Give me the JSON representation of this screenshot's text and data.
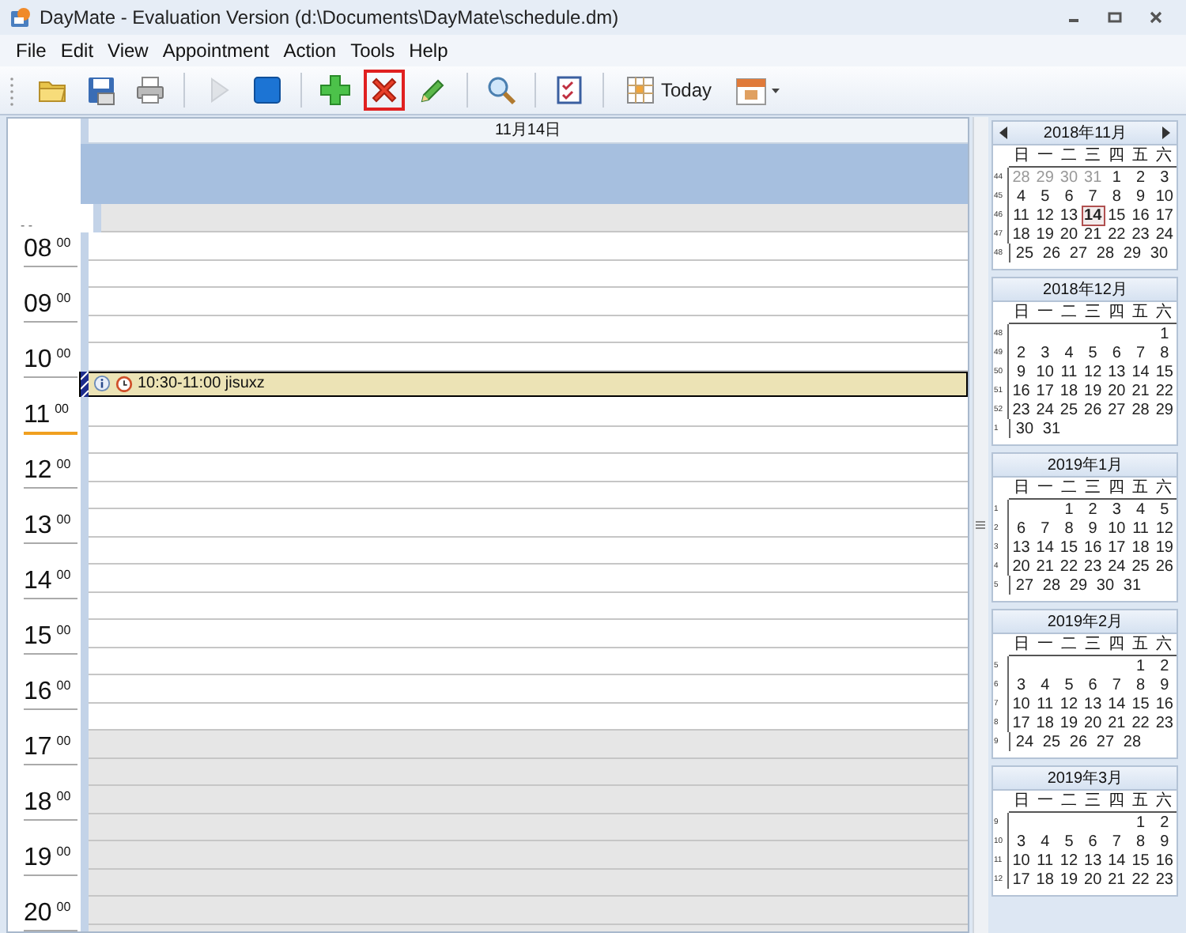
{
  "window": {
    "title": "DayMate - Evaluation Version (d:\\Documents\\DayMate\\schedule.dm)"
  },
  "menu": [
    {
      "label": "File"
    },
    {
      "label": "Edit"
    },
    {
      "label": "View"
    },
    {
      "label": "Appointment"
    },
    {
      "label": "Action"
    },
    {
      "label": "Tools"
    },
    {
      "label": "Help"
    }
  ],
  "toolbar": [
    {
      "kind": "open",
      "disabled": false,
      "highlighted": false
    },
    {
      "kind": "save",
      "disabled": false,
      "highlighted": false
    },
    {
      "kind": "print",
      "disabled": false,
      "highlighted": false
    },
    {
      "kind": "separator"
    },
    {
      "kind": "run",
      "disabled": true,
      "highlighted": false
    },
    {
      "kind": "stop",
      "disabled": false,
      "highlighted": false
    },
    {
      "kind": "separator"
    },
    {
      "kind": "add",
      "disabled": false,
      "highlighted": false
    },
    {
      "kind": "delete",
      "disabled": false,
      "highlighted": true
    },
    {
      "kind": "edit",
      "disabled": false,
      "highlighted": false
    },
    {
      "kind": "separator"
    },
    {
      "kind": "find",
      "disabled": false,
      "highlighted": false
    },
    {
      "kind": "separator"
    },
    {
      "kind": "tasks",
      "disabled": false,
      "highlighted": false
    },
    {
      "kind": "separator"
    },
    {
      "kind": "today",
      "label": "Today",
      "disabled": false,
      "highlighted": false
    },
    {
      "kind": "calendar",
      "disabled": false,
      "highlighted": false
    }
  ],
  "day_view": {
    "date": "11月14日",
    "top_slot_label": "- -",
    "hours": [
      {
        "hour": "08",
        "minutes": "00",
        "work": true,
        "now": false
      },
      {
        "hour": "09",
        "minutes": "00",
        "work": true,
        "now": false
      },
      {
        "hour": "10",
        "minutes": "00",
        "work": true,
        "now": false,
        "half_past_appointment": {
          "text": "10:30-11:00 jisuxz"
        }
      },
      {
        "hour": "11",
        "minutes": "00",
        "work": true,
        "now": true
      },
      {
        "hour": "12",
        "minutes": "00",
        "work": true,
        "now": false
      },
      {
        "hour": "13",
        "minutes": "00",
        "work": true,
        "now": false
      },
      {
        "hour": "14",
        "minutes": "00",
        "work": true,
        "now": false
      },
      {
        "hour": "15",
        "minutes": "00",
        "work": true,
        "now": false
      },
      {
        "hour": "16",
        "minutes": "00",
        "work": true,
        "now": false
      },
      {
        "hour": "17",
        "minutes": "00",
        "work": false,
        "now": false
      },
      {
        "hour": "18",
        "minutes": "00",
        "work": false,
        "now": false
      },
      {
        "hour": "19",
        "minutes": "00",
        "work": false,
        "now": false
      },
      {
        "hour": "20",
        "minutes": "00",
        "work": false,
        "now": false
      }
    ]
  },
  "months": [
    {
      "title": "2018年11月",
      "nav": true,
      "weekdays": [
        "日",
        "一",
        "二",
        "三",
        "四",
        "五",
        "六"
      ],
      "weeks": [
        {
          "week": "44",
          "days": [
            {
              "d": "28",
              "other_month": true,
              "today": false
            },
            {
              "d": "29",
              "other_month": true,
              "today": false
            },
            {
              "d": "30",
              "other_month": true,
              "today": false
            },
            {
              "d": "31",
              "other_month": true,
              "today": false
            },
            {
              "d": "1",
              "other_month": false,
              "today": false
            },
            {
              "d": "2",
              "other_month": false,
              "today": false
            },
            {
              "d": "3",
              "other_month": false,
              "today": false
            }
          ]
        },
        {
          "week": "45",
          "days": [
            {
              "d": "4",
              "other_month": false,
              "today": false
            },
            {
              "d": "5",
              "other_month": false,
              "today": false
            },
            {
              "d": "6",
              "other_month": false,
              "today": false
            },
            {
              "d": "7",
              "other_month": false,
              "today": false
            },
            {
              "d": "8",
              "other_month": false,
              "today": false
            },
            {
              "d": "9",
              "other_month": false,
              "today": false
            },
            {
              "d": "10",
              "other_month": false,
              "today": false
            }
          ]
        },
        {
          "week": "46",
          "days": [
            {
              "d": "11",
              "other_month": false,
              "today": false
            },
            {
              "d": "12",
              "other_month": false,
              "today": false
            },
            {
              "d": "13",
              "other_month": false,
              "today": false
            },
            {
              "d": "14",
              "other_month": false,
              "today": true
            },
            {
              "d": "15",
              "other_month": false,
              "today": false
            },
            {
              "d": "16",
              "other_month": false,
              "today": false
            },
            {
              "d": "17",
              "other_month": false,
              "today": false
            }
          ]
        },
        {
          "week": "47",
          "days": [
            {
              "d": "18",
              "other_month": false,
              "today": false
            },
            {
              "d": "19",
              "other_month": false,
              "today": false
            },
            {
              "d": "20",
              "other_month": false,
              "today": false
            },
            {
              "d": "21",
              "other_month": false,
              "today": false
            },
            {
              "d": "22",
              "other_month": false,
              "today": false
            },
            {
              "d": "23",
              "other_month": false,
              "today": false
            },
            {
              "d": "24",
              "other_month": false,
              "today": false
            }
          ]
        },
        {
          "week": "48",
          "days": [
            {
              "d": "25",
              "other_month": false,
              "today": false
            },
            {
              "d": "26",
              "other_month": false,
              "today": false
            },
            {
              "d": "27",
              "other_month": false,
              "today": false
            },
            {
              "d": "28",
              "other_month": false,
              "today": false
            },
            {
              "d": "29",
              "other_month": false,
              "today": false
            },
            {
              "d": "30",
              "other_month": false,
              "today": false
            }
          ]
        }
      ]
    },
    {
      "title": "2018年12月",
      "nav": false,
      "weekdays": [
        "日",
        "一",
        "二",
        "三",
        "四",
        "五",
        "六"
      ],
      "weeks": [
        {
          "week": "48",
          "days": [
            {
              "d": "1",
              "other_month": false,
              "today": false
            }
          ]
        },
        {
          "week": "49",
          "days": [
            {
              "d": "2",
              "other_month": false,
              "today": false
            },
            {
              "d": "3",
              "other_month": false,
              "today": false
            },
            {
              "d": "4",
              "other_month": false,
              "today": false
            },
            {
              "d": "5",
              "other_month": false,
              "today": false
            },
            {
              "d": "6",
              "other_month": false,
              "today": false
            },
            {
              "d": "7",
              "other_month": false,
              "today": false
            },
            {
              "d": "8",
              "other_month": false,
              "today": false
            }
          ]
        },
        {
          "week": "50",
          "days": [
            {
              "d": "9",
              "other_month": false,
              "today": false
            },
            {
              "d": "10",
              "other_month": false,
              "today": false
            },
            {
              "d": "11",
              "other_month": false,
              "today": false
            },
            {
              "d": "12",
              "other_month": false,
              "today": false
            },
            {
              "d": "13",
              "other_month": false,
              "today": false
            },
            {
              "d": "14",
              "other_month": false,
              "today": false
            },
            {
              "d": "15",
              "other_month": false,
              "today": false
            }
          ]
        },
        {
          "week": "51",
          "days": [
            {
              "d": "16",
              "other_month": false,
              "today": false
            },
            {
              "d": "17",
              "other_month": false,
              "today": false
            },
            {
              "d": "18",
              "other_month": false,
              "today": false
            },
            {
              "d": "19",
              "other_month": false,
              "today": false
            },
            {
              "d": "20",
              "other_month": false,
              "today": false
            },
            {
              "d": "21",
              "other_month": false,
              "today": false
            },
            {
              "d": "22",
              "other_month": false,
              "today": false
            }
          ]
        },
        {
          "week": "52",
          "days": [
            {
              "d": "23",
              "other_month": false,
              "today": false
            },
            {
              "d": "24",
              "other_month": false,
              "today": false
            },
            {
              "d": "25",
              "other_month": false,
              "today": false
            },
            {
              "d": "26",
              "other_month": false,
              "today": false
            },
            {
              "d": "27",
              "other_month": false,
              "today": false
            },
            {
              "d": "28",
              "other_month": false,
              "today": false
            },
            {
              "d": "29",
              "other_month": false,
              "today": false
            }
          ]
        },
        {
          "week": "1",
          "days": [
            {
              "d": "30",
              "other_month": false,
              "today": false
            },
            {
              "d": "31",
              "other_month": false,
              "today": false
            }
          ]
        }
      ]
    },
    {
      "title": "2019年1月",
      "nav": false,
      "weekdays": [
        "日",
        "一",
        "二",
        "三",
        "四",
        "五",
        "六"
      ],
      "weeks": [
        {
          "week": "1",
          "days": [
            {
              "d": "1",
              "other_month": false,
              "today": false
            },
            {
              "d": "2",
              "other_month": false,
              "today": false
            },
            {
              "d": "3",
              "other_month": false,
              "today": false
            },
            {
              "d": "4",
              "other_month": false,
              "today": false
            },
            {
              "d": "5",
              "other_month": false,
              "today": false
            }
          ]
        },
        {
          "week": "2",
          "days": [
            {
              "d": "6",
              "other_month": false,
              "today": false
            },
            {
              "d": "7",
              "other_month": false,
              "today": false
            },
            {
              "d": "8",
              "other_month": false,
              "today": false
            },
            {
              "d": "9",
              "other_month": false,
              "today": false
            },
            {
              "d": "10",
              "other_month": false,
              "today": false
            },
            {
              "d": "11",
              "other_month": false,
              "today": false
            },
            {
              "d": "12",
              "other_month": false,
              "today": false
            }
          ]
        },
        {
          "week": "3",
          "days": [
            {
              "d": "13",
              "other_month": false,
              "today": false
            },
            {
              "d": "14",
              "other_month": false,
              "today": false
            },
            {
              "d": "15",
              "other_month": false,
              "today": false
            },
            {
              "d": "16",
              "other_month": false,
              "today": false
            },
            {
              "d": "17",
              "other_month": false,
              "today": false
            },
            {
              "d": "18",
              "other_month": false,
              "today": false
            },
            {
              "d": "19",
              "other_month": false,
              "today": false
            }
          ]
        },
        {
          "week": "4",
          "days": [
            {
              "d": "20",
              "other_month": false,
              "today": false
            },
            {
              "d": "21",
              "other_month": false,
              "today": false
            },
            {
              "d": "22",
              "other_month": false,
              "today": false
            },
            {
              "d": "23",
              "other_month": false,
              "today": false
            },
            {
              "d": "24",
              "other_month": false,
              "today": false
            },
            {
              "d": "25",
              "other_month": false,
              "today": false
            },
            {
              "d": "26",
              "other_month": false,
              "today": false
            }
          ]
        },
        {
          "week": "5",
          "days": [
            {
              "d": "27",
              "other_month": false,
              "today": false
            },
            {
              "d": "28",
              "other_month": false,
              "today": false
            },
            {
              "d": "29",
              "other_month": false,
              "today": false
            },
            {
              "d": "30",
              "other_month": false,
              "today": false
            },
            {
              "d": "31",
              "other_month": false,
              "today": false
            }
          ]
        }
      ]
    },
    {
      "title": "2019年2月",
      "nav": false,
      "weekdays": [
        "日",
        "一",
        "二",
        "三",
        "四",
        "五",
        "六"
      ],
      "weeks": [
        {
          "week": "5",
          "days": [
            {
              "d": "1",
              "other_month": false,
              "today": false
            },
            {
              "d": "2",
              "other_month": false,
              "today": false
            }
          ]
        },
        {
          "week": "6",
          "days": [
            {
              "d": "3",
              "other_month": false,
              "today": false
            },
            {
              "d": "4",
              "other_month": false,
              "today": false
            },
            {
              "d": "5",
              "other_month": false,
              "today": false
            },
            {
              "d": "6",
              "other_month": false,
              "today": false
            },
            {
              "d": "7",
              "other_month": false,
              "today": false
            },
            {
              "d": "8",
              "other_month": false,
              "today": false
            },
            {
              "d": "9",
              "other_month": false,
              "today": false
            }
          ]
        },
        {
          "week": "7",
          "days": [
            {
              "d": "10",
              "other_month": false,
              "today": false
            },
            {
              "d": "11",
              "other_month": false,
              "today": false
            },
            {
              "d": "12",
              "other_month": false,
              "today": false
            },
            {
              "d": "13",
              "other_month": false,
              "today": false
            },
            {
              "d": "14",
              "other_month": false,
              "today": false
            },
            {
              "d": "15",
              "other_month": false,
              "today": false
            },
            {
              "d": "16",
              "other_month": false,
              "today": false
            }
          ]
        },
        {
          "week": "8",
          "days": [
            {
              "d": "17",
              "other_month": false,
              "today": false
            },
            {
              "d": "18",
              "other_month": false,
              "today": false
            },
            {
              "d": "19",
              "other_month": false,
              "today": false
            },
            {
              "d": "20",
              "other_month": false,
              "today": false
            },
            {
              "d": "21",
              "other_month": false,
              "today": false
            },
            {
              "d": "22",
              "other_month": false,
              "today": false
            },
            {
              "d": "23",
              "other_month": false,
              "today": false
            }
          ]
        },
        {
          "week": "9",
          "days": [
            {
              "d": "24",
              "other_month": false,
              "today": false
            },
            {
              "d": "25",
              "other_month": false,
              "today": false
            },
            {
              "d": "26",
              "other_month": false,
              "today": false
            },
            {
              "d": "27",
              "other_month": false,
              "today": false
            },
            {
              "d": "28",
              "other_month": false,
              "today": false
            }
          ]
        }
      ]
    },
    {
      "title": "2019年3月",
      "nav": false,
      "weekdays": [
        "日",
        "一",
        "二",
        "三",
        "四",
        "五",
        "六"
      ],
      "weeks": [
        {
          "week": "9",
          "days": [
            {
              "d": "1",
              "other_month": false,
              "today": false
            },
            {
              "d": "2",
              "other_month": false,
              "today": false
            }
          ]
        },
        {
          "week": "10",
          "days": [
            {
              "d": "3",
              "other_month": false,
              "today": false
            },
            {
              "d": "4",
              "other_month": false,
              "today": false
            },
            {
              "d": "5",
              "other_month": false,
              "today": false
            },
            {
              "d": "6",
              "other_month": false,
              "today": false
            },
            {
              "d": "7",
              "other_month": false,
              "today": false
            },
            {
              "d": "8",
              "other_month": false,
              "today": false
            },
            {
              "d": "9",
              "other_month": false,
              "today": false
            }
          ]
        },
        {
          "week": "11",
          "days": [
            {
              "d": "10",
              "other_month": false,
              "today": false
            },
            {
              "d": "11",
              "other_month": false,
              "today": false
            },
            {
              "d": "12",
              "other_month": false,
              "today": false
            },
            {
              "d": "13",
              "other_month": false,
              "today": false
            },
            {
              "d": "14",
              "other_month": false,
              "today": false
            },
            {
              "d": "15",
              "other_month": false,
              "today": false
            },
            {
              "d": "16",
              "other_month": false,
              "today": false
            }
          ]
        },
        {
          "week": "12",
          "days": [
            {
              "d": "17",
              "other_month": false,
              "today": false
            },
            {
              "d": "18",
              "other_month": false,
              "today": false
            },
            {
              "d": "19",
              "other_month": false,
              "today": false
            },
            {
              "d": "20",
              "other_month": false,
              "today": false
            },
            {
              "d": "21",
              "other_month": false,
              "today": false
            },
            {
              "d": "22",
              "other_month": false,
              "today": false
            },
            {
              "d": "23",
              "other_month": false,
              "today": false
            }
          ]
        }
      ]
    }
  ]
}
